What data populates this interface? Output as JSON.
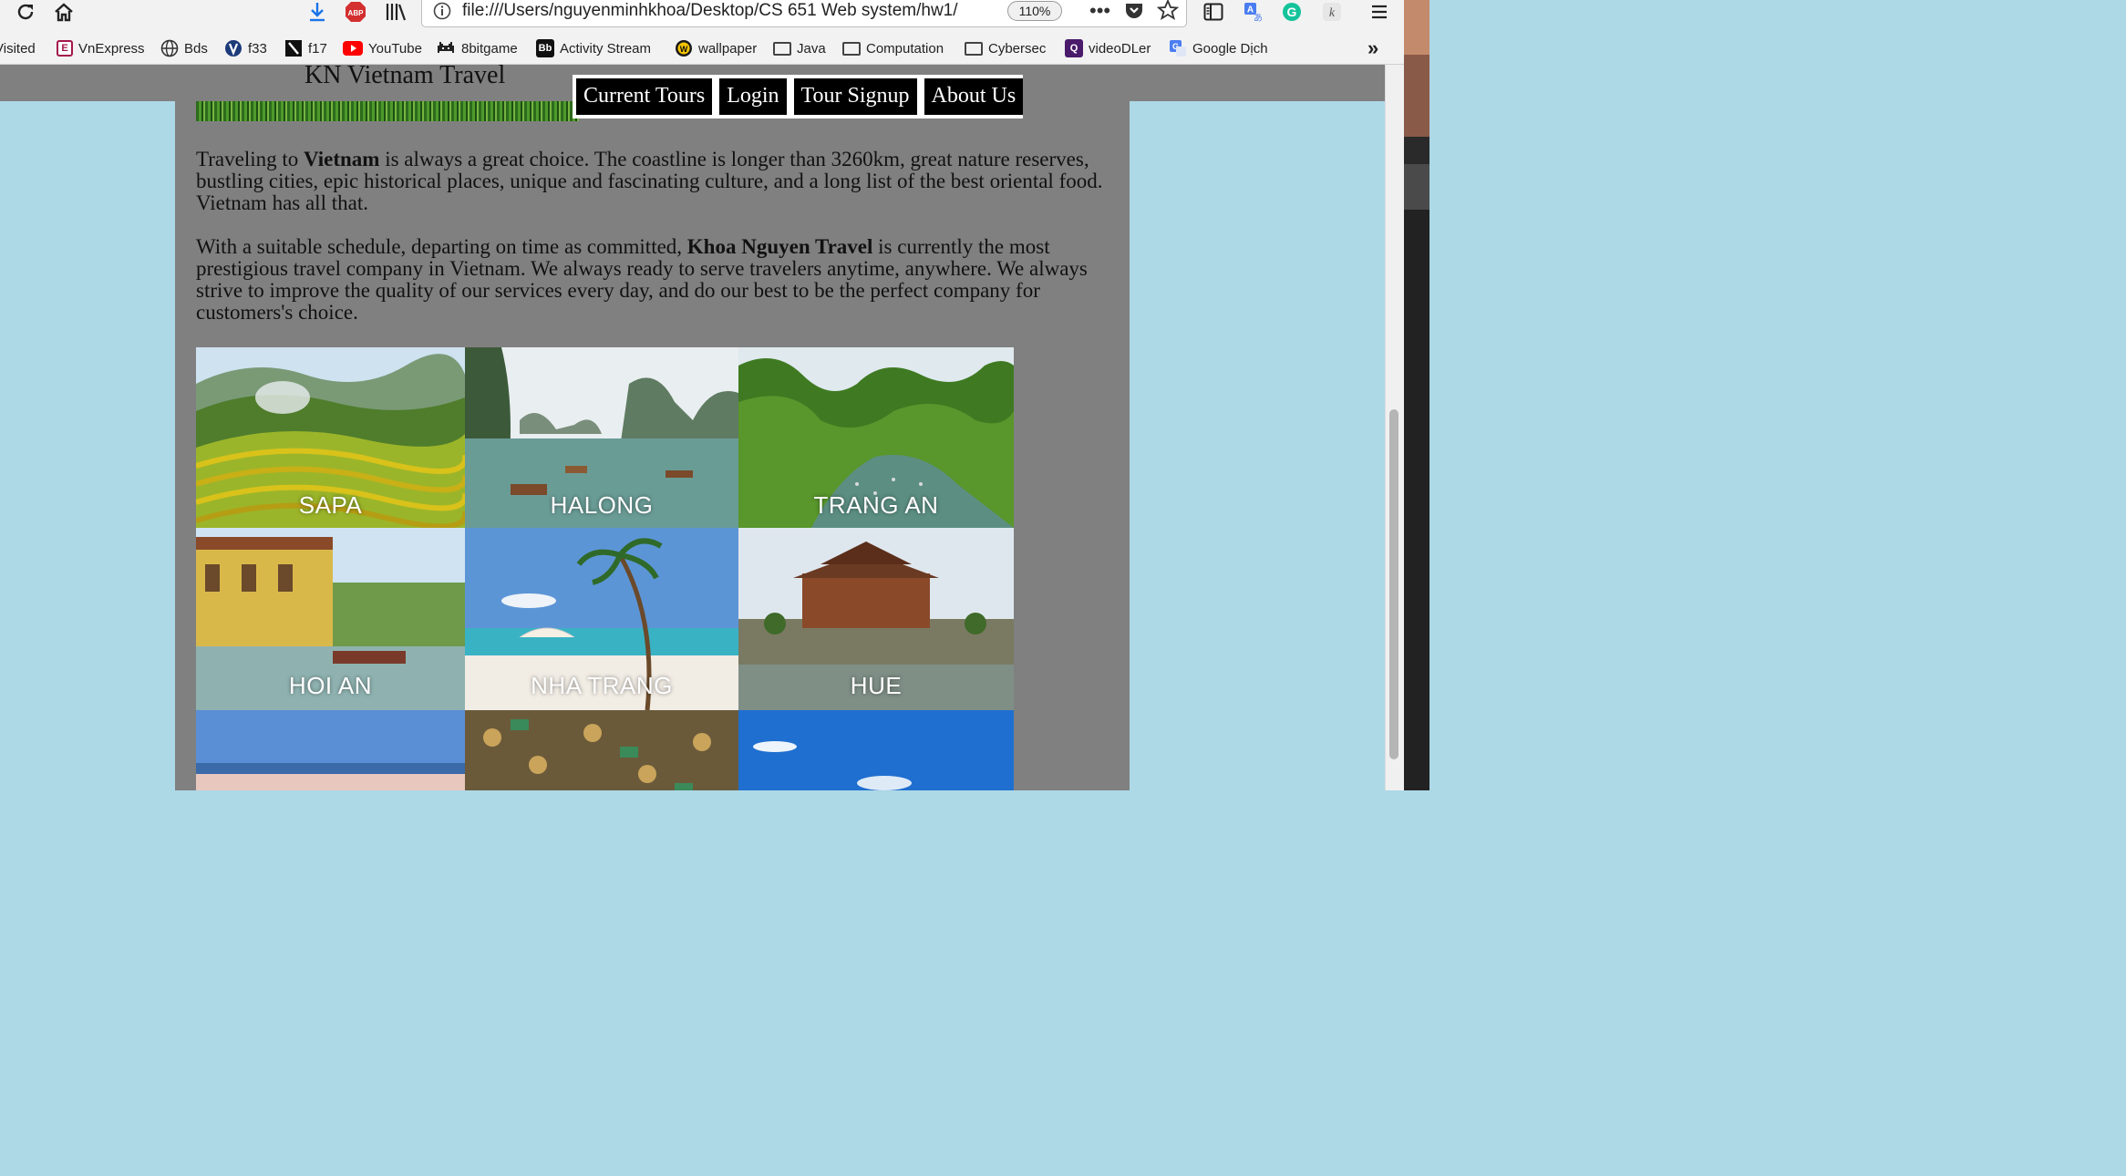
{
  "browser": {
    "url": "file:///Users/nguyenminhkhoa/Desktop/CS 651 Web system/hw1/",
    "zoom": "110%"
  },
  "bookmarks": [
    {
      "label": "Visited",
      "icon": "none"
    },
    {
      "label": "VnExpress",
      "icon": "vnexpress-icon"
    },
    {
      "label": "Bds",
      "icon": "globe-icon"
    },
    {
      "label": "f33",
      "icon": "v-icon"
    },
    {
      "label": "f17",
      "icon": "flag-icon"
    },
    {
      "label": "YouTube",
      "icon": "youtube-icon"
    },
    {
      "label": "8bitgame",
      "icon": "invader-icon"
    },
    {
      "label": "Activity Stream",
      "icon": "bb-icon"
    },
    {
      "label": "wallpaper",
      "icon": "w-icon"
    },
    {
      "label": "Java",
      "icon": "folder-icon"
    },
    {
      "label": "Computation",
      "icon": "folder-icon"
    },
    {
      "label": "Cybersec",
      "icon": "folder-icon"
    },
    {
      "label": "videoDLer",
      "icon": "q-icon"
    },
    {
      "label": "Google Dịch",
      "icon": "translate-icon"
    }
  ],
  "site": {
    "title": "KN Vietnam Travel",
    "nav": [
      "Current Tours",
      "Login",
      "Tour Signup",
      "About Us"
    ],
    "p1": {
      "a": "Traveling to ",
      "b": "Vietnam",
      "c": " is always a great choice. The coastline is longer than 3260km, great nature reserves, bustling cities, epic historical places, unique and fascinating culture, and a long list of the best oriental food. Vietnam has all that."
    },
    "p2": {
      "a": "With a suitable schedule, departing on time as committed, ",
      "b": "Khoa Nguyen Travel",
      "c": " is currently the most prestigious travel company in Vietnam. We always ready to serve travelers anytime, anywhere. We always strive to improve the quality of our services every day, and do our best to be the perfect company for customers's choice."
    },
    "destinations": [
      "SAPA",
      "HALONG",
      "TRANG AN",
      "HOI AN",
      "NHA TRANG",
      "HUE"
    ]
  },
  "colors": {
    "page_bg": "#add8e6",
    "content_bg": "#808080",
    "nav_bg": "#000000",
    "nav_text": "#ffffff"
  }
}
